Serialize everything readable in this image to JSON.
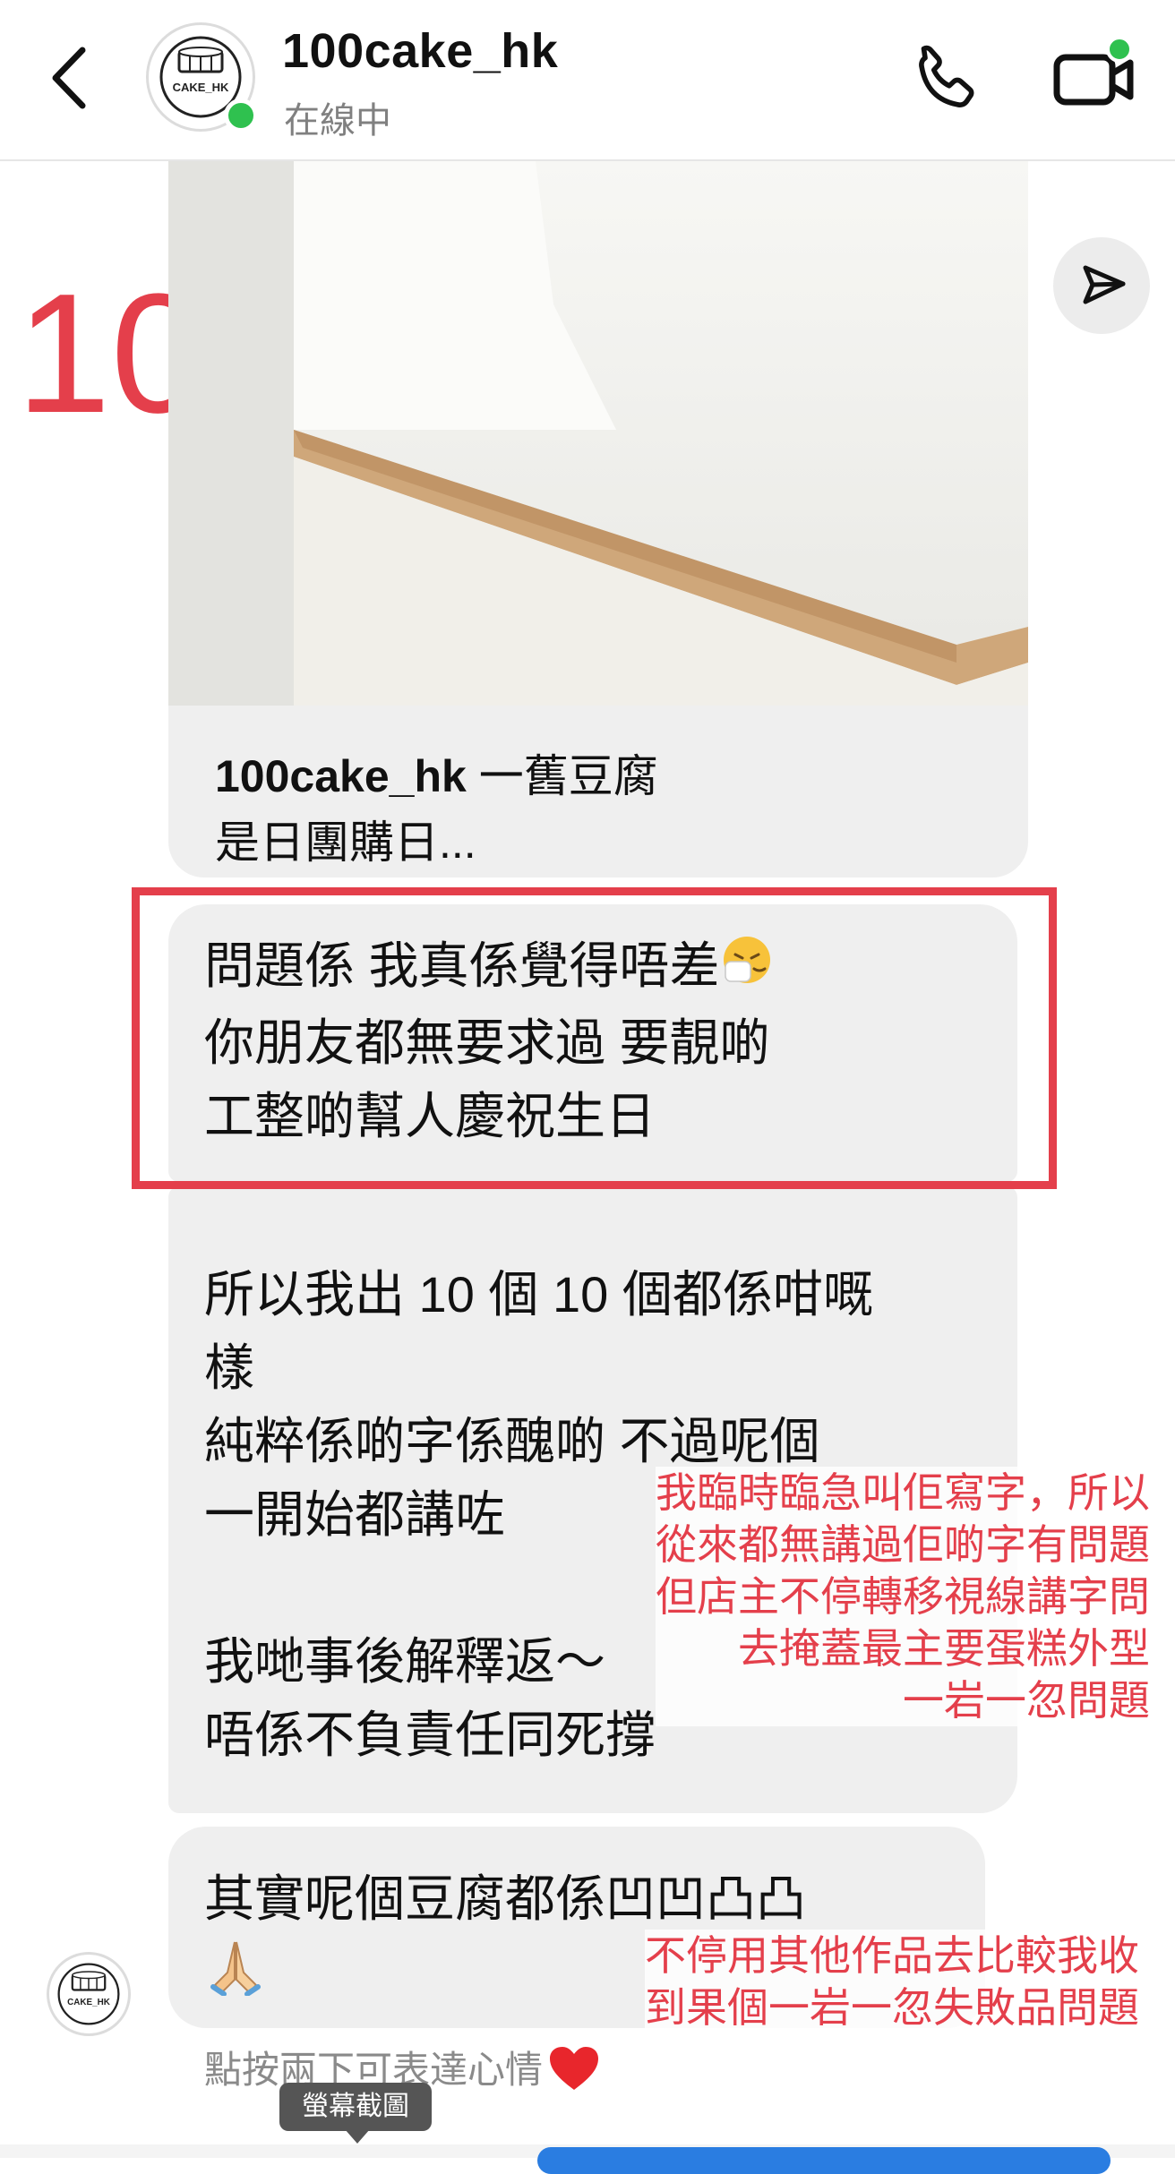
{
  "header": {
    "username": "100cake_hk",
    "status": "在線中",
    "avatar_text": "CAKE_HK",
    "icons": [
      "back-arrow-icon",
      "phone-icon",
      "video-call-icon"
    ]
  },
  "annotation_number": "10",
  "shared_post": {
    "caption_user": "100cake_hk",
    "caption_text": " 一舊豆腐",
    "caption_line2": "是日團購日..."
  },
  "messages": {
    "bubble1": [
      "問題係 我真係覺得唔差",
      "你朋友都無要求過 要靚啲",
      "工整啲幫人慶祝生日"
    ],
    "bubble2": [
      "所以我出 10 個 10 個都係咁嘅",
      "樣",
      "純粹係啲字係醜啲 不過呢個",
      "一開始都講咗",
      "我哋事後解釋返～",
      "唔係不負責任同死撐"
    ],
    "bubble3": [
      "其實呢個豆腐都係凹凹凸凸"
    ]
  },
  "notes": {
    "note1": [
      "我臨時臨急叫佢寫字，所以",
      "從來都無講過佢啲字有問題",
      "但店主不停轉移視線講字問",
      "去掩蓋最主要蛋糕外型",
      "一岩一忽問題"
    ],
    "note2": [
      "不停用其他作品去比較我收",
      "到果個一岩一忽失敗品問題"
    ]
  },
  "reaction_hint": "點按兩下可表達心情",
  "screenshot_tip": "螢幕截圖",
  "colors": {
    "accent_red": "#e43f4b",
    "online_green": "#2fc14f",
    "bubble_gray": "#efefef"
  }
}
